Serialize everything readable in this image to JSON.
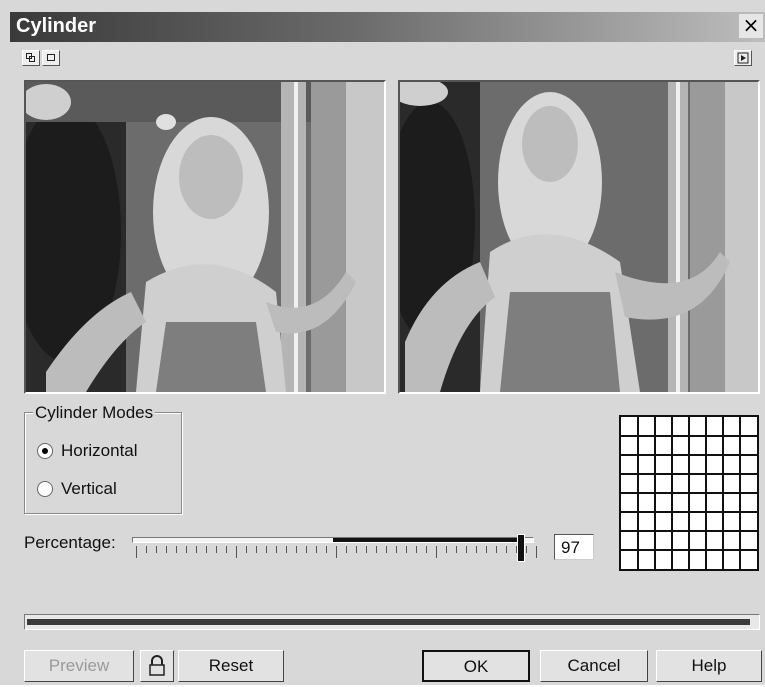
{
  "window": {
    "title": "Cylinder",
    "close_glyph": "×"
  },
  "toolbar": {
    "left_buttons": [
      {
        "icon": "dual-view-icon"
      },
      {
        "icon": "single-view-icon"
      }
    ],
    "right_button": {
      "icon": "play-icon"
    }
  },
  "previews": {
    "original": {
      "description": "before"
    },
    "result": {
      "description": "after"
    }
  },
  "modes": {
    "legend": "Cylinder Modes",
    "options": [
      {
        "label": "Horizontal",
        "selected": true
      },
      {
        "label": "Vertical",
        "selected": false
      }
    ]
  },
  "percentage": {
    "label": "Percentage:",
    "value": "97",
    "fraction": 0.97
  },
  "progress": {
    "fraction": 0.99
  },
  "buttons": {
    "preview": "Preview",
    "reset": "Reset",
    "ok": "OK",
    "cancel": "Cancel",
    "help": "Help"
  },
  "colors": {
    "titlebar_dark": "#3a3a3a",
    "dialog_bg": "#d8d8d8"
  }
}
